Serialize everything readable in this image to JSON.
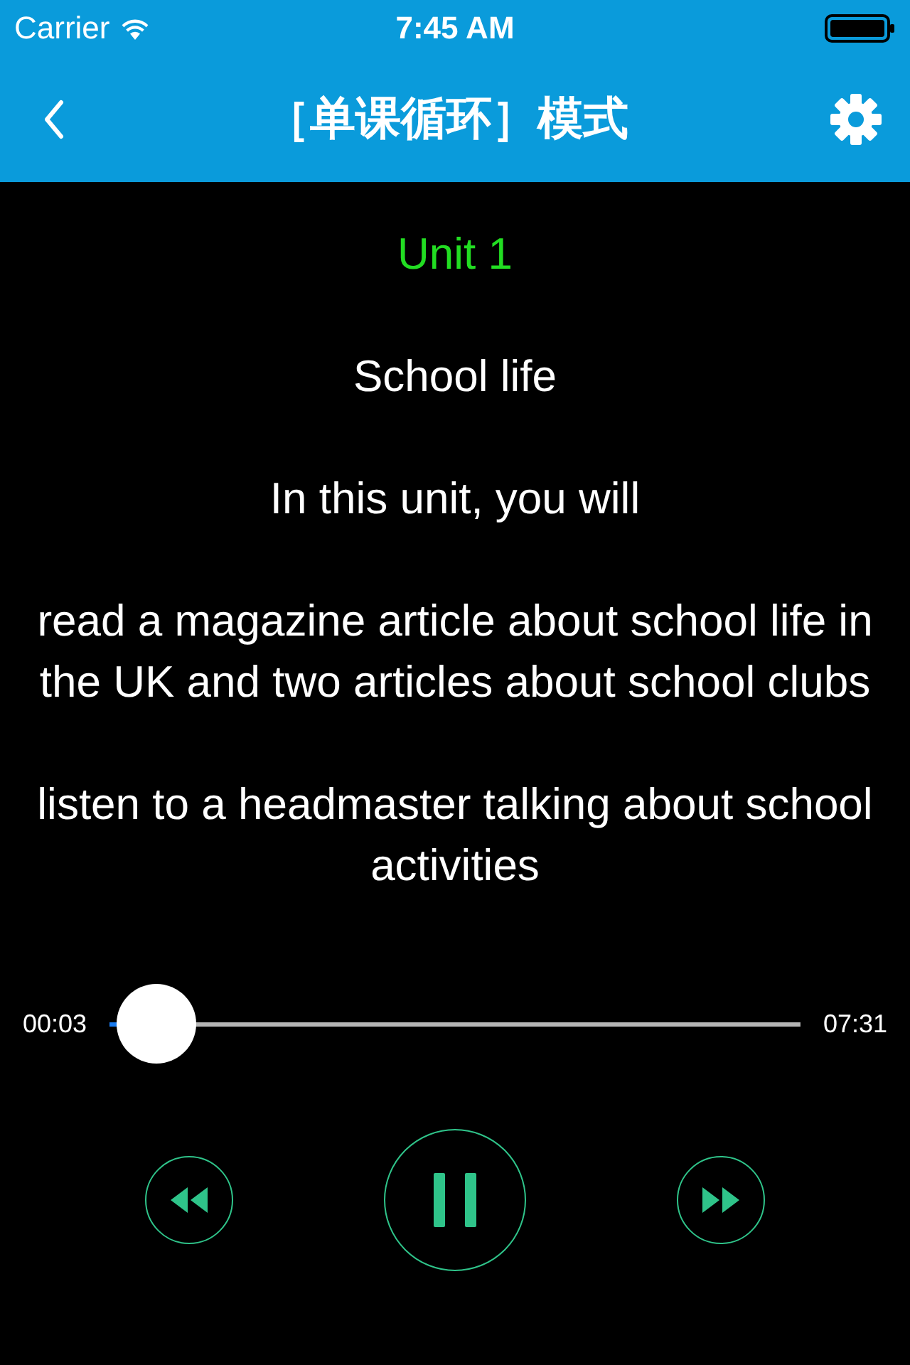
{
  "status_bar": {
    "carrier": "Carrier",
    "time": "7:45 AM"
  },
  "nav": {
    "title": "［单课循环］模式"
  },
  "lyrics": [
    {
      "text": "Unit 1",
      "selected": true
    },
    {
      "text": "School life",
      "selected": false
    },
    {
      "text": "In this unit, you will",
      "selected": false
    },
    {
      "text": "read a magazine article about school life in the UK and two articles about school clubs",
      "selected": false
    },
    {
      "text": "listen to a headmaster talking about school activities",
      "selected": false
    }
  ],
  "player": {
    "elapsed": "00:03",
    "total": "07:31",
    "level": 0.01,
    "playing": true
  }
}
